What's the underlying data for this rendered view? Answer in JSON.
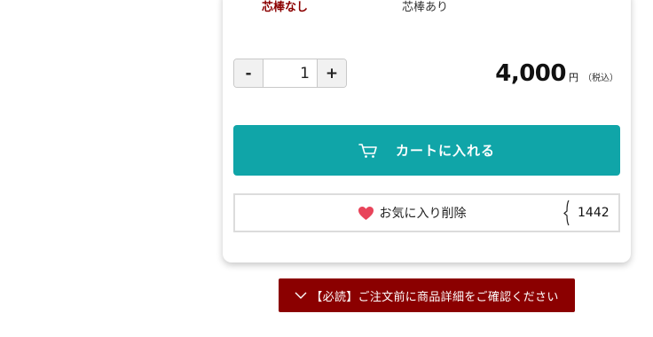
{
  "options": {
    "selected_label": "芯棒なし",
    "other_label": "芯棒あり"
  },
  "quantity": {
    "minus_label": "-",
    "value": "1",
    "plus_label": "+"
  },
  "price": {
    "amount": "4,000",
    "unit": "円",
    "tax_note": "（税込）"
  },
  "cart_button": {
    "label": "カートに入れる",
    "icon": "cart-icon"
  },
  "favorite": {
    "label": "お気に入り削除",
    "icon": "heart-icon",
    "count": "1442"
  },
  "notice": {
    "label": "【必読】ご注文前に商品詳細をご確認ください",
    "icon": "chevron-down-icon"
  },
  "colors": {
    "accent_teal": "#10a5a8",
    "notice_red": "#8b0000",
    "selected_option": "#8b0000",
    "heart": "#e8445a"
  }
}
